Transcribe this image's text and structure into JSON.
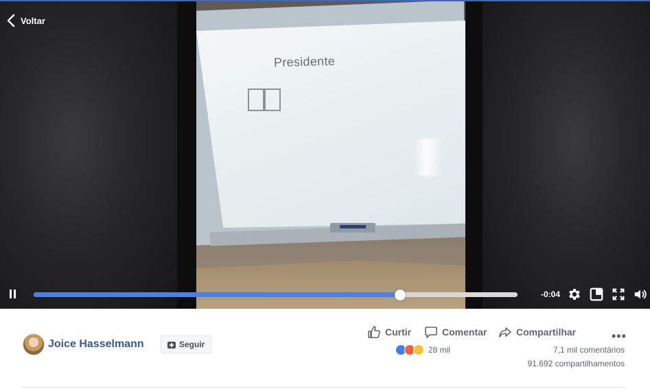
{
  "player": {
    "back_label": "Voltar",
    "screen_text": "Presidente",
    "time_remaining": "-0:04",
    "progress": 0.757,
    "accent_color": "#4a80e8",
    "icons": [
      "chevron-left-icon",
      "pause-icon",
      "gear-icon",
      "miniplayer-icon",
      "fullscreen-icon",
      "volume-icon"
    ]
  },
  "post": {
    "author": "Joice Hasselmann",
    "follow_label": "Seguir",
    "actions": {
      "like": "Curtir",
      "comment": "Comentar",
      "share": "Compartilhar"
    },
    "reactions_count": "28 mil",
    "comments_count": "7,1 mil comentários",
    "shares_count": "91.692 compartilhamentos",
    "link_color": "#385898"
  }
}
